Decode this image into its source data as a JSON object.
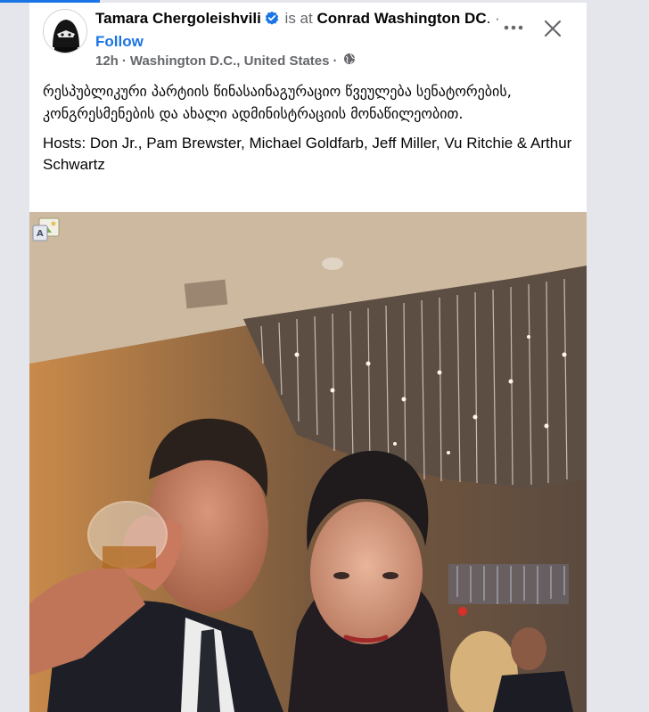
{
  "post": {
    "author": "Tamara Chergoleishvili",
    "is_at": "is at",
    "place": "Conrad Washington DC",
    "place_suffix": ".",
    "separator": "·",
    "follow_label": "Follow",
    "time": "12h",
    "location": "Washington D.C., United States",
    "audience_icon": "globe-icon",
    "verified_icon": "verified-badge-icon",
    "text_georgian": "რესპუბლიკური პარტიის წინასაინაგურაციო წვეულება სენატორების, კონგრესმენების და ახალი ადმინისტრაციის მონაწილეობით.",
    "text_hosts": "Hosts: Don Jr., Pam Brewster, Michael Goldfarb, Jeff Miller, Vu Ritchie & Arthur Schwartz"
  },
  "colors": {
    "accent": "#1b74e4",
    "text": "#050505",
    "secondary": "#65676b"
  }
}
